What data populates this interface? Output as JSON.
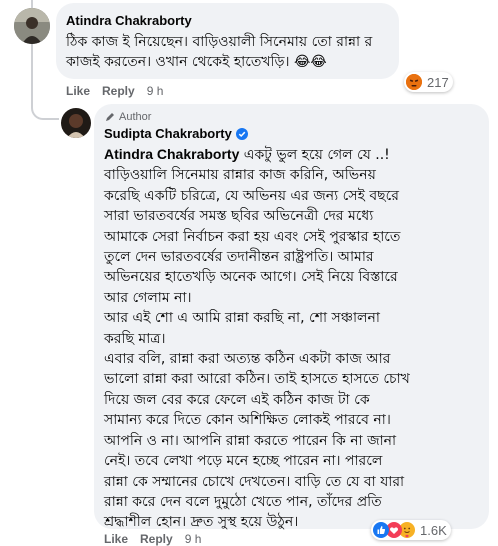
{
  "comment1": {
    "author": "Atindra Chakraborty",
    "lines": [
      "ঠিক কাজ ই নিয়েছেন। বাড়িওয়ালী সিনেমায় তো রান্না র",
      "কাজই করতেন। ওখান থেকেই হাতেখড়ি। 😂😂"
    ],
    "like_label": "Like",
    "reply_label": "Reply",
    "time": "9 h",
    "reaction_count": "217",
    "reaction_icon": "angry-face-icon"
  },
  "reply": {
    "author_badge": "Author",
    "author": "Sudipta Chakraborty",
    "verified_icon": "verified-badge-icon",
    "mention": "Atindra Chakraborty",
    "first_line_rest": " একটু ভুল হয়ে গেল যে ..!",
    "lines": [
      "বাড়িওয়ালি সিনেমায় রান্নার কাজ করিনি, অভিনয়",
      "করেছি একটি চরিত্রে, যে অভিনয় এর জন্য সেই বছরে",
      "সারা ভারতবর্ষের সমস্ত ছবির অভিনেত্রী দের মধ্যে",
      "আমাকে সেরা নির্বাচন করা হয় এবং সেই পুরস্কার হাতে",
      "তুলে দেন ভারতবর্ষের তদানীন্তন রাষ্ট্রপতি। আমার",
      "অভিনয়ের হাতেখড়ি অনেক আগে। সেই নিয়ে বিস্তারে",
      "আর গেলাম না।",
      "আর এই শো এ আমি রান্না করছি না, শো সঞ্চালনা",
      "করছি মাত্র।",
      "এবার বলি, রান্না করা অত্যন্ত কঠিন একটা কাজ আর",
      "ভালো রান্না করা আরো কঠিন। তাই হাসতে হাসতে চোখ",
      "দিয়ে জল বের করে ফেলে এই কঠিন কাজ টা কে",
      "সামান্য করে দিতে কোন অশিক্ষিত লোকই পারবে না।",
      "আপনি ও না। আপনি রান্না করতে পারেন কি না জানা",
      "নেই। তবে লেখা পড়ে মনে হচ্ছে পারেন না। পারলে",
      "রান্না কে সম্মানের চোখে দেখতেন। বাড়ি তে যে বা যারা",
      "রান্না করে দেন বলে দুমুঠো খেতে পান, তাঁদের প্রতি",
      "শ্রদ্ধাশীল হোন। দ্রুত সুস্থ হয়ে উঠুন।"
    ],
    "like_label": "Like",
    "reply_label": "Reply",
    "time": "9 h",
    "reaction_count": "1.6K",
    "reaction_icons": [
      "like-icon",
      "love-icon",
      "care-icon"
    ]
  },
  "colors": {
    "bubble": "#f0f2f5",
    "meta": "#65676b",
    "like_blue": "#1877f2",
    "love_red": "#f33e58",
    "angry": "#e9710f",
    "care": "#f7b125"
  }
}
